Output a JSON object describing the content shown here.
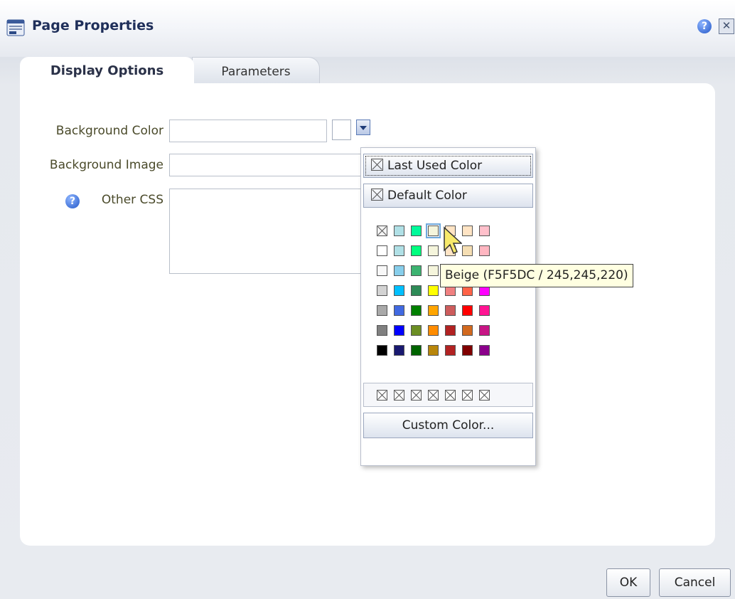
{
  "dialog": {
    "title": "Page Properties",
    "help_icon": "help-icon",
    "close_icon": "close-icon"
  },
  "tabs": [
    {
      "label": "Display Options",
      "active": true
    },
    {
      "label": "Parameters",
      "active": false
    }
  ],
  "form": {
    "background_color_label": "Background Color",
    "background_color_value": "",
    "background_image_label": "Background Image",
    "background_image_value": "",
    "other_css_label": "Other CSS",
    "other_css_value": ""
  },
  "color_popup": {
    "last_used_label": "Last Used Color",
    "default_label": "Default Color",
    "custom_label": "Custom Color...",
    "grid": [
      [
        "none",
        "#B0E0E6",
        "#00FA9A",
        "#F5F5DC",
        "#FFE4C4",
        "#FFE4C4",
        "#FFC0CB"
      ],
      [
        "#FFFFFF",
        "#B0E0E6",
        "#00FF7F",
        "#F5F5DC",
        "#FFE4C4",
        "#F5DEB3",
        "#FFB6C1"
      ],
      [
        "#F8F8F8",
        "#87CEEB",
        "#3CB371",
        "#F5F5DC",
        "#F4A460",
        "#F08080",
        "#FF69B4"
      ],
      [
        "#D3D3D3",
        "#00BFFF",
        "#2E8B57",
        "#FFFF00",
        "#F08080",
        "#FF6347",
        "#FF00FF"
      ],
      [
        "#A9A9A9",
        "#4169E1",
        "#008000",
        "#FFA500",
        "#CD5C5C",
        "#FF0000",
        "#FF1493"
      ],
      [
        "#808080",
        "#0000FF",
        "#6B8E23",
        "#FF8C00",
        "#B22222",
        "#D2691E",
        "#C71585"
      ],
      [
        "#000000",
        "#191970",
        "#006400",
        "#B8860B",
        "#B22222",
        "#800000",
        "#8B008B"
      ]
    ],
    "custom_slots": 7,
    "tooltip": "Beige (F5F5DC / 245,245,220)"
  },
  "footer": {
    "ok_label": "OK",
    "cancel_label": "Cancel"
  }
}
